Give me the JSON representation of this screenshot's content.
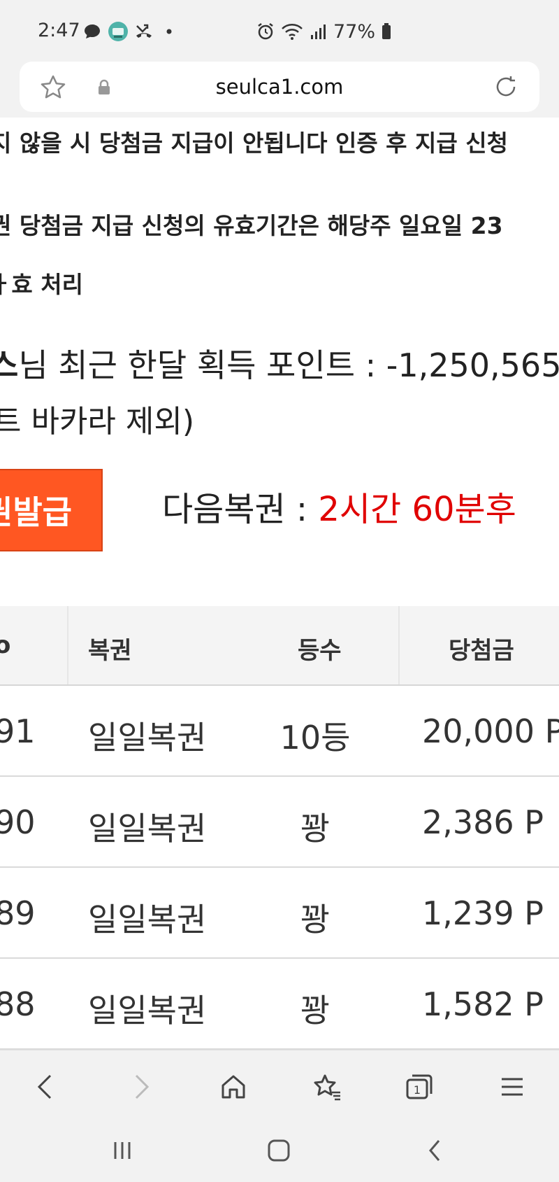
{
  "status_bar": {
    "time": "2:47",
    "battery": "77%",
    "left_icons": [
      "chat-bubble-icon",
      "app-avatar-icon",
      "missed-call-icon",
      "dot-icon"
    ],
    "right_icons": [
      "alarm-icon",
      "wifi-icon",
      "signal-icon",
      "battery-icon"
    ]
  },
  "browser": {
    "url": "seulca1.com"
  },
  "notices": {
    "line1": "지 않을 시 당첨금 지급이 안됩니다 인증 후 지급 신청",
    "line2": "권 당첨금 지급 신청의 유효기간은 해당주 일요일 23",
    "line3": "ㅏ효 처리"
  },
  "points": {
    "user_suffix": "스",
    "label": "님 최근 한달 획득 포인트 : -1,250,565",
    "line2": "트 바카라 제외)"
  },
  "actions": {
    "issue_label": "권발급",
    "next_label": "다음복권 : ",
    "countdown": "2시간 60분후",
    "countdown_color": "#e00000",
    "button_color": "#ff5722"
  },
  "table": {
    "headers": {
      "no": "o",
      "name": "복권",
      "rank": "등수",
      "prize": "당첨금"
    },
    "rows": [
      {
        "no": "91",
        "name": "일일복권",
        "rank": "10등",
        "prize": "20,000 P"
      },
      {
        "no": "90",
        "name": "일일복권",
        "rank": "꽝",
        "prize": "2,386 P"
      },
      {
        "no": "89",
        "name": "일일복권",
        "rank": "꽝",
        "prize": "1,239 P"
      },
      {
        "no": "88",
        "name": "일일복권",
        "rank": "꽝",
        "prize": "1,582 P"
      }
    ]
  },
  "toolbar_icons": [
    "back-icon",
    "forward-icon",
    "home-icon",
    "bookmarks-icon",
    "tabs-icon",
    "menu-icon"
  ],
  "tabs_count": "1",
  "system_nav_icons": [
    "recent-apps-icon",
    "home-button-icon",
    "system-back-icon"
  ]
}
